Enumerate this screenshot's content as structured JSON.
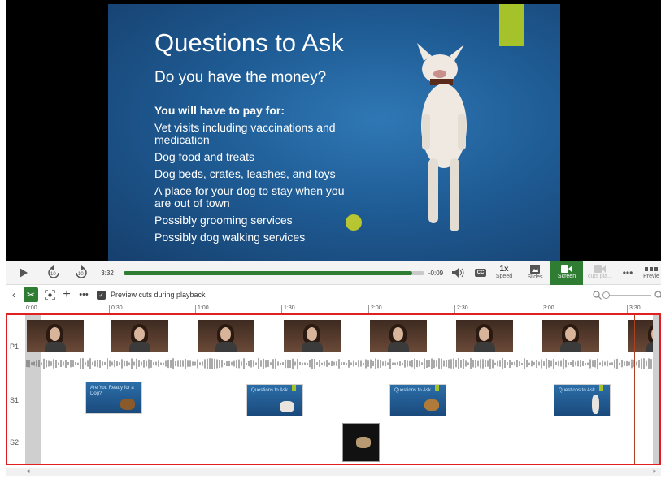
{
  "slide": {
    "title": "Questions to Ask",
    "subtitle": "Do you have the money?",
    "list_heading": "You will have to pay for:",
    "bullets": [
      "Vet visits including vaccinations and medication",
      "Dog food and treats",
      "Dog beds, crates, leashes, and toys",
      "A place for your dog to stay when you are out of town",
      "Possibly grooming services",
      "Possibly dog walking services"
    ]
  },
  "player": {
    "current_time": "3:32",
    "remaining_time": "-0:09",
    "progress_fraction": 0.96,
    "cc_label": "CC",
    "speed_value": "1x",
    "speed_label": "Speed",
    "slides_label": "Slides",
    "screen_label": "Screen",
    "cut_label": "cuts pla...",
    "preview_label": "Previe"
  },
  "edit_toolbar": {
    "preview_cuts_label": "Preview cuts during playback"
  },
  "ruler": {
    "ticks": [
      "0:00",
      "0:30",
      "1:00",
      "1:30",
      "2:00",
      "2:30",
      "3:00",
      "3:30"
    ]
  },
  "tracks": {
    "p1_label": "P1",
    "s1_label": "S1",
    "s2_label": "S2",
    "s1_slide_titles": [
      "Are You Ready for a Dog?",
      "Questions to Ask",
      "Questions to Ask",
      "Questions to Ask"
    ]
  },
  "colors": {
    "accent_green": "#2e7d32",
    "selection_red": "#e02020",
    "slide_accent": "#a6c22b"
  }
}
